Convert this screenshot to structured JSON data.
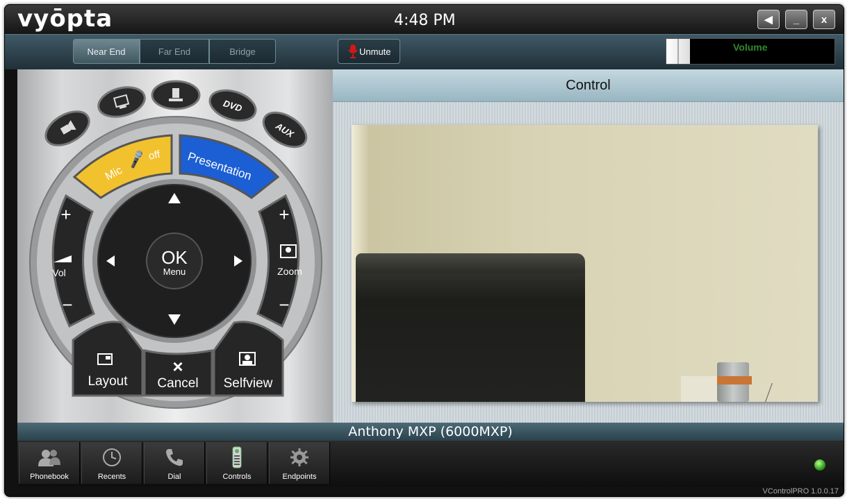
{
  "app": {
    "brand": "vyōpta",
    "clock": "4:48 PM",
    "version": "VControlPRO 1.0.0.17"
  },
  "window_controls": {
    "back": "◀",
    "minimize": "_",
    "close": "x"
  },
  "tabs": [
    {
      "label": "Near End",
      "active": true
    },
    {
      "label": "Far End",
      "active": false
    },
    {
      "label": "Bridge",
      "active": false
    }
  ],
  "mute_button": {
    "label": "Unmute",
    "icon": "microphone-muted-icon"
  },
  "volume": {
    "label": "Volume",
    "level_fraction": 0.14
  },
  "remote": {
    "top_keys": [
      "",
      "",
      "",
      "DVD",
      "AUX"
    ],
    "mic_label": "Mic",
    "mic_state": "off",
    "presentation": "Presentation",
    "vol_label": "Vol",
    "zoom_label": "Zoom",
    "ok_label": "OK",
    "menu_label": "Menu",
    "plus": "+",
    "minus": "−",
    "layout": "Layout",
    "cancel": "Cancel",
    "selfview": "Selfview"
  },
  "control_panel": {
    "title": "Control"
  },
  "status": {
    "endpoint_name": "Anthony MXP (6000MXP)"
  },
  "nav": [
    {
      "label": "Phonebook",
      "icon": "people-icon"
    },
    {
      "label": "Recents",
      "icon": "clock-icon"
    },
    {
      "label": "Dial",
      "icon": "phone-icon"
    },
    {
      "label": "Controls",
      "icon": "remote-icon"
    },
    {
      "label": "Endpoints",
      "icon": "gear-icon"
    }
  ],
  "colors": {
    "accent_teal": "#3f5a66",
    "mic_yellow": "#f2c12e",
    "presentation_blue": "#1c5fd4",
    "online_green": "#2f9a1d"
  }
}
